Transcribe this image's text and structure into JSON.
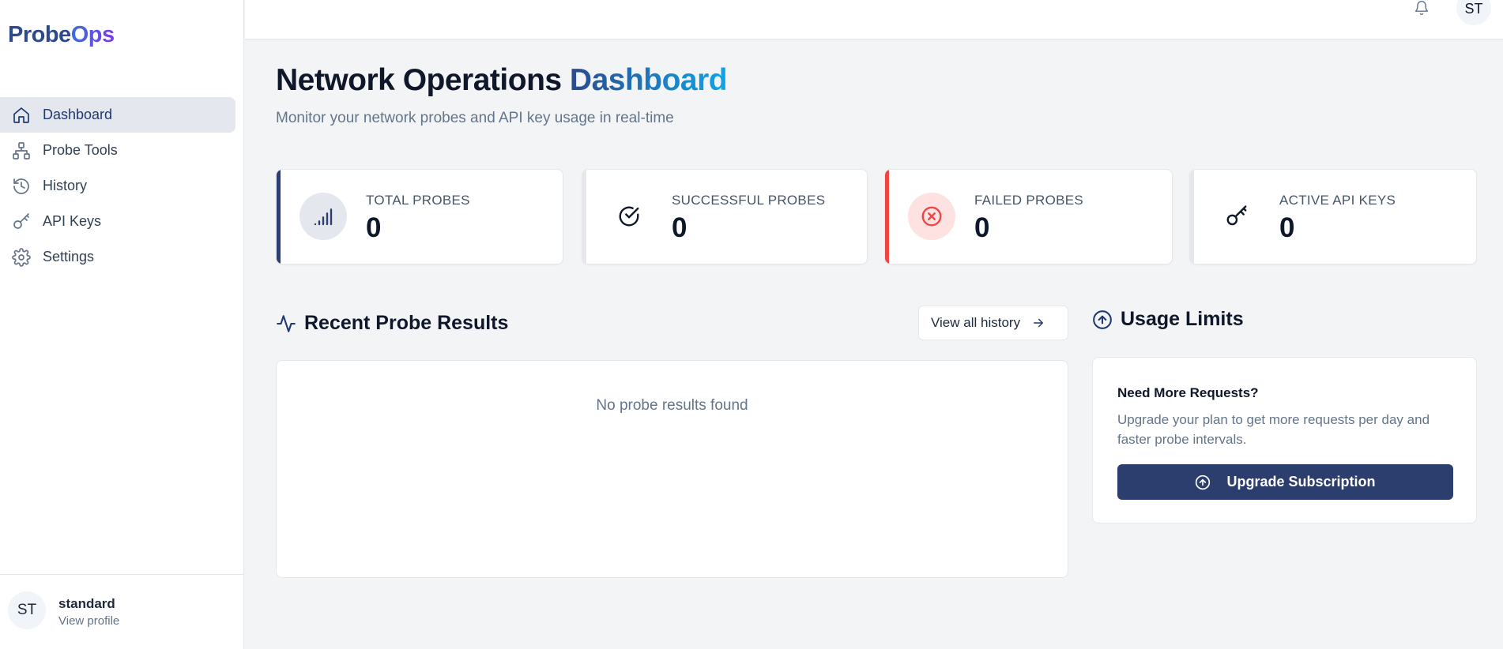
{
  "brand": {
    "part1": "Probe",
    "part2": "Ops"
  },
  "sidebar": {
    "items": [
      {
        "label": "Dashboard",
        "icon": "home-icon",
        "active": true
      },
      {
        "label": "Probe Tools",
        "icon": "network-icon"
      },
      {
        "label": "History",
        "icon": "history-icon"
      },
      {
        "label": "API Keys",
        "icon": "key-icon"
      },
      {
        "label": "Settings",
        "icon": "gear-icon"
      }
    ],
    "profile": {
      "initials": "ST",
      "name": "standard",
      "link": "View profile"
    }
  },
  "topbar": {
    "avatar_initials": "ST",
    "notification_icon": "bell-icon"
  },
  "header": {
    "title": "Network Operations",
    "title_highlight": "Dashboard",
    "subtitle": "Monitor your network probes and API key usage in real-time"
  },
  "stats": [
    {
      "label": "TOTAL PROBES",
      "value": "0",
      "icon": "signal-icon",
      "accent": "#2c3e6e"
    },
    {
      "label": "SUCCESSFUL PROBES",
      "value": "0",
      "icon": "check-circle-icon",
      "accent": "#e5e7eb"
    },
    {
      "label": "FAILED PROBES",
      "value": "0",
      "icon": "x-circle-icon",
      "accent": "#ef4444"
    },
    {
      "label": "ACTIVE API KEYS",
      "value": "0",
      "icon": "key-icon",
      "accent": "#e5e7eb"
    }
  ],
  "recent": {
    "title": "Recent Probe Results",
    "view_all_label": "View all history",
    "empty_text": "No probe results found"
  },
  "usage": {
    "title": "Usage Limits",
    "card_heading": "Need More Requests?",
    "card_text": "Upgrade your plan to get more requests per day and faster probe intervals.",
    "button_label": "Upgrade Subscription"
  },
  "colors": {
    "primary": "#2c3e6e",
    "danger": "#ef4444",
    "accent_blue": "#0ea5e9"
  }
}
